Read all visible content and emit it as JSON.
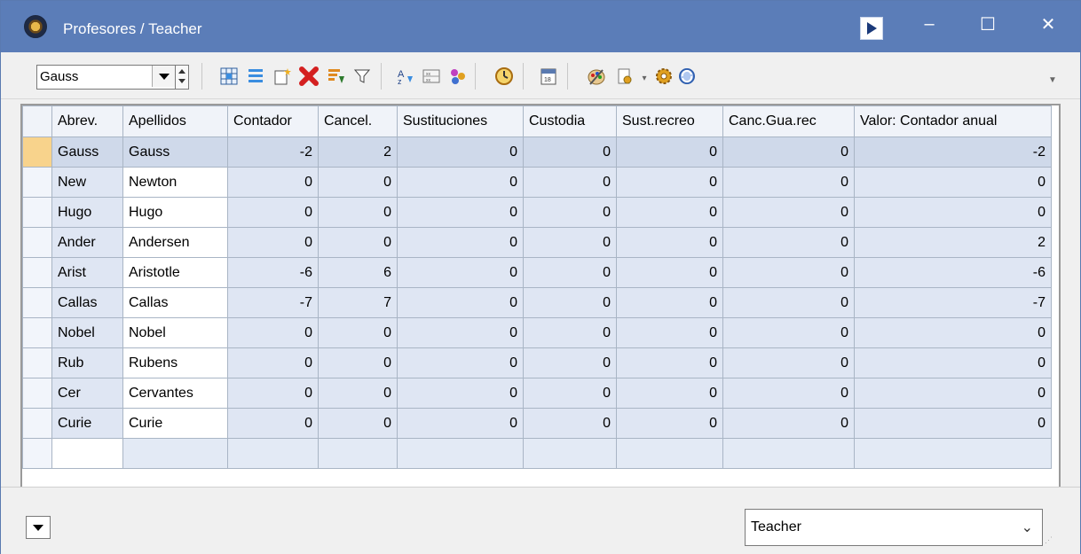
{
  "window": {
    "title": "Profesores / Teacher"
  },
  "titlebar_buttons": {
    "minimize": "–",
    "maximize": "☐",
    "close": "✕"
  },
  "toolbar": {
    "selector_value": "Gauss",
    "icons": [
      "grid-add-icon",
      "list-icon",
      "new-record-icon",
      "delete-icon",
      "sort-icon",
      "filter-icon",
      "alphabet-sort-icon",
      "table-icon",
      "connections-icon",
      "clock-icon",
      "calendar-icon",
      "palette-icon",
      "report-icon",
      "settings-icon",
      "refresh-icon"
    ]
  },
  "table": {
    "columns": [
      "Abrev.",
      "Apellidos",
      "Contador",
      "Cancel.",
      "Sustituciones",
      "Custodia",
      "Sust.recreo",
      "Canc.Gua.rec",
      "Valor: Contador anual"
    ],
    "rows": [
      [
        "Gauss",
        "Gauss",
        "-2",
        "2",
        "0",
        "0",
        "0",
        "0",
        "-2"
      ],
      [
        "New",
        "Newton",
        "0",
        "0",
        "0",
        "0",
        "0",
        "0",
        "0"
      ],
      [
        "Hugo",
        "Hugo",
        "0",
        "0",
        "0",
        "0",
        "0",
        "0",
        "0"
      ],
      [
        "Ander",
        "Andersen",
        "0",
        "0",
        "0",
        "0",
        "0",
        "0",
        "2"
      ],
      [
        "Arist",
        "Aristotle",
        "-6",
        "6",
        "0",
        "0",
        "0",
        "0",
        "-6"
      ],
      [
        "Callas",
        "Callas",
        "-7",
        "7",
        "0",
        "0",
        "0",
        "0",
        "-7"
      ],
      [
        "Nobel",
        "Nobel",
        "0",
        "0",
        "0",
        "0",
        "0",
        "0",
        "0"
      ],
      [
        "Rub",
        "Rubens",
        "0",
        "0",
        "0",
        "0",
        "0",
        "0",
        "0"
      ],
      [
        "Cer",
        "Cervantes",
        "0",
        "0",
        "0",
        "0",
        "0",
        "0",
        "0"
      ],
      [
        "Curie",
        "Curie",
        "0",
        "0",
        "0",
        "0",
        "0",
        "0",
        "0"
      ]
    ]
  },
  "bottom": {
    "type_selector_value": "Teacher"
  }
}
